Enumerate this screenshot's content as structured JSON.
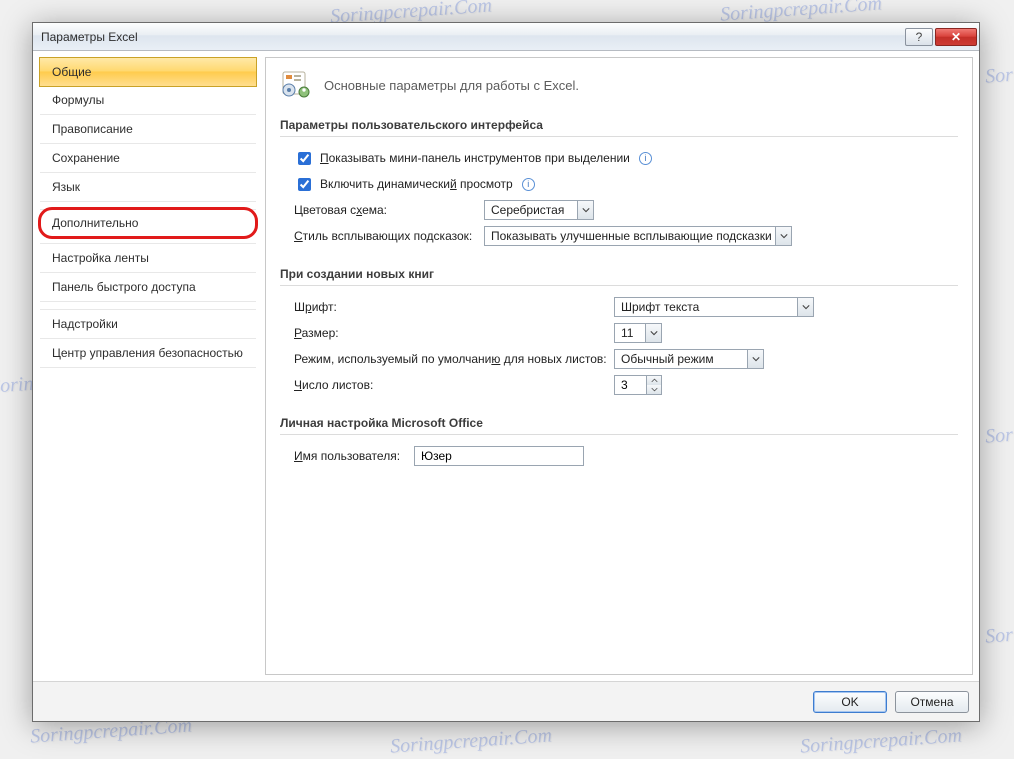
{
  "watermark_text": "Soringpcrepair.Com",
  "titlebar": {
    "title": "Параметры Excel"
  },
  "sidebar": {
    "items": [
      {
        "label": "Общие",
        "active": true
      },
      {
        "label": "Формулы"
      },
      {
        "label": "Правописание"
      },
      {
        "label": "Сохранение"
      },
      {
        "label": "Язык"
      },
      {
        "label": "Дополнительно",
        "highlight": true
      },
      {
        "label": "Настройка ленты"
      },
      {
        "label": "Панель быстрого доступа"
      },
      {
        "label": "Надстройки"
      },
      {
        "label": "Центр управления безопасностью"
      }
    ]
  },
  "page": {
    "heading": "Основные параметры для работы с Excel.",
    "section_ui": {
      "title": "Параметры пользовательского интерфейса",
      "chk_mini_toolbar": "Показывать мини-панель инструментов при выделении",
      "chk_live_preview": "Включить динамический просмотр",
      "color_scheme_label": "Цветовая схема:",
      "color_scheme_value": "Серебристая",
      "tooltip_style_label": "Стиль всплывающих подсказок:",
      "tooltip_style_value": "Показывать улучшенные всплывающие подсказки"
    },
    "section_newbook": {
      "title": "При создании новых книг",
      "font_label": "Шрифт:",
      "font_value": "Шрифт текста",
      "size_label": "Размер:",
      "size_value": "11",
      "view_label": "Режим, используемый по умолчанию для новых листов:",
      "view_value": "Обычный режим",
      "sheets_label": "Число листов:",
      "sheets_value": "3"
    },
    "section_personal": {
      "title": "Личная настройка Microsoft Office",
      "username_label": "Имя пользователя:",
      "username_value": "Юзер"
    }
  },
  "footer": {
    "ok": "OK",
    "cancel": "Отмена"
  }
}
